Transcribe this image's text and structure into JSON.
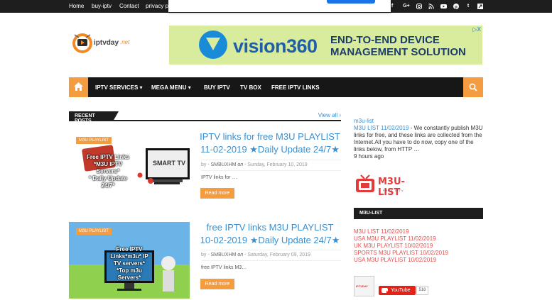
{
  "topnav": [
    "Home",
    "buy-iptv",
    "Contact",
    "privacy p"
  ],
  "social": [
    "facebook-icon",
    "google-plus-icon",
    "instagram-icon",
    "rss-icon",
    "youtube-icon",
    "pinterest-icon",
    "tumblr-icon",
    "share-icon"
  ],
  "logo": {
    "text": "iptvday",
    "suffix": ".net"
  },
  "ad": {
    "brand": "vision360",
    "tagline1": "END-TO-END DEVICE",
    "tagline2": "MANAGEMENT SOLUTION",
    "close": "▷X"
  },
  "nav": {
    "items": [
      "IPTV SERVICES ▾",
      "MEGA MENU ▾",
      "BUY IPTV",
      "TV BOX",
      "FREE IPTV LINKS"
    ]
  },
  "recent": {
    "title": "RECENT POSTS",
    "view_all": "View all ›"
  },
  "posts": [
    {
      "label": "M3U PLAYLIST",
      "thumb_lines": [
        "Free IPTV Links",
        "*M3U IPTV",
        "Servers*",
        "* Daily Update",
        "24/7*"
      ],
      "thumb_tv": "SMART TV",
      "title": "IPTV links for free M3U PLAYLIST 11-02-2019 ★Daily Update 24/7★",
      "author": "SMBUXHM",
      "on": "on",
      "date": "Sunday, February 10, 2019",
      "excerpt": "IPTV links for …",
      "read_more": "Read more"
    },
    {
      "label": "M3U PLAYLIST",
      "thumb_lines": [
        "Free IPTV",
        "Links*m3u* IP",
        "TV servers*",
        "*Top m3u",
        "Servers*"
      ],
      "thumb_tv": "",
      "title": "free IPTV links M3U PLAYLIST 10-02-2019 ★Daily Update 24/7★",
      "author": "SMBUXHM",
      "on": "on",
      "date": "Saturday, February 09, 2019",
      "excerpt": "free IPTV links M3…",
      "read_more": "Read more"
    }
  ],
  "sidebar": {
    "recent_cat": "m3u-list",
    "recent_title": "M3U LIST 11/02/2019",
    "recent_text": " - We constantly publish M3U links for free, and these links are collected from the Internet.All you have to do now, copy one of the links below, from HTTP …",
    "recent_time": "9 hours ago",
    "logo_text": "M3U-LIST",
    "logo_sub": "FREE IPTV",
    "widget_title": "M3U-LIST",
    "links": [
      "M3U LIST 11/02/2019",
      "USA M3U PLAYLIST 11/02/2019",
      "UK M3U PLAYLIST 10/02/2019",
      "SPORTS M3U PLAYLIST 10/02/2019",
      "USA M3U PLAYLIST 10/02/2019"
    ],
    "yt_label": "YouTube",
    "yt_count": "516",
    "yt_avatar_text": "IPTVDAY"
  }
}
